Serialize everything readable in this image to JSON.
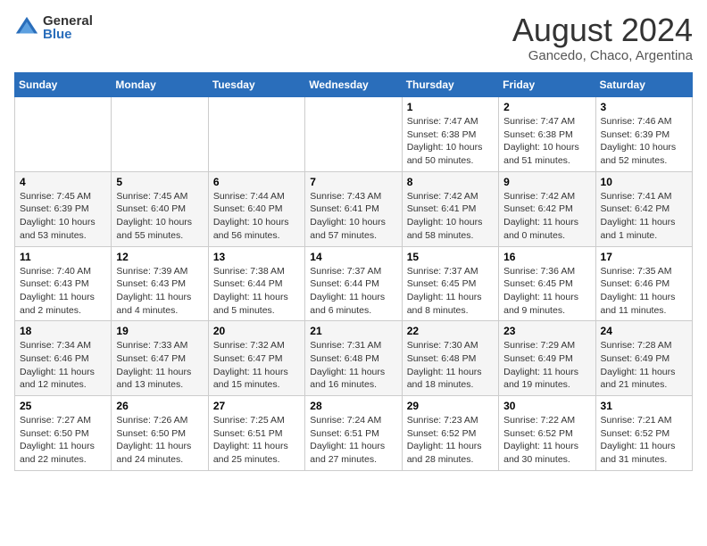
{
  "header": {
    "logo_general": "General",
    "logo_blue": "Blue",
    "title": "August 2024",
    "subtitle": "Gancedo, Chaco, Argentina"
  },
  "weekdays": [
    "Sunday",
    "Monday",
    "Tuesday",
    "Wednesday",
    "Thursday",
    "Friday",
    "Saturday"
  ],
  "weeks": [
    [
      {
        "day": "",
        "info": ""
      },
      {
        "day": "",
        "info": ""
      },
      {
        "day": "",
        "info": ""
      },
      {
        "day": "",
        "info": ""
      },
      {
        "day": "1",
        "info": "Sunrise: 7:47 AM\nSunset: 6:38 PM\nDaylight: 10 hours and 50 minutes."
      },
      {
        "day": "2",
        "info": "Sunrise: 7:47 AM\nSunset: 6:38 PM\nDaylight: 10 hours and 51 minutes."
      },
      {
        "day": "3",
        "info": "Sunrise: 7:46 AM\nSunset: 6:39 PM\nDaylight: 10 hours and 52 minutes."
      }
    ],
    [
      {
        "day": "4",
        "info": "Sunrise: 7:45 AM\nSunset: 6:39 PM\nDaylight: 10 hours and 53 minutes."
      },
      {
        "day": "5",
        "info": "Sunrise: 7:45 AM\nSunset: 6:40 PM\nDaylight: 10 hours and 55 minutes."
      },
      {
        "day": "6",
        "info": "Sunrise: 7:44 AM\nSunset: 6:40 PM\nDaylight: 10 hours and 56 minutes."
      },
      {
        "day": "7",
        "info": "Sunrise: 7:43 AM\nSunset: 6:41 PM\nDaylight: 10 hours and 57 minutes."
      },
      {
        "day": "8",
        "info": "Sunrise: 7:42 AM\nSunset: 6:41 PM\nDaylight: 10 hours and 58 minutes."
      },
      {
        "day": "9",
        "info": "Sunrise: 7:42 AM\nSunset: 6:42 PM\nDaylight: 11 hours and 0 minutes."
      },
      {
        "day": "10",
        "info": "Sunrise: 7:41 AM\nSunset: 6:42 PM\nDaylight: 11 hours and 1 minute."
      }
    ],
    [
      {
        "day": "11",
        "info": "Sunrise: 7:40 AM\nSunset: 6:43 PM\nDaylight: 11 hours and 2 minutes."
      },
      {
        "day": "12",
        "info": "Sunrise: 7:39 AM\nSunset: 6:43 PM\nDaylight: 11 hours and 4 minutes."
      },
      {
        "day": "13",
        "info": "Sunrise: 7:38 AM\nSunset: 6:44 PM\nDaylight: 11 hours and 5 minutes."
      },
      {
        "day": "14",
        "info": "Sunrise: 7:37 AM\nSunset: 6:44 PM\nDaylight: 11 hours and 6 minutes."
      },
      {
        "day": "15",
        "info": "Sunrise: 7:37 AM\nSunset: 6:45 PM\nDaylight: 11 hours and 8 minutes."
      },
      {
        "day": "16",
        "info": "Sunrise: 7:36 AM\nSunset: 6:45 PM\nDaylight: 11 hours and 9 minutes."
      },
      {
        "day": "17",
        "info": "Sunrise: 7:35 AM\nSunset: 6:46 PM\nDaylight: 11 hours and 11 minutes."
      }
    ],
    [
      {
        "day": "18",
        "info": "Sunrise: 7:34 AM\nSunset: 6:46 PM\nDaylight: 11 hours and 12 minutes."
      },
      {
        "day": "19",
        "info": "Sunrise: 7:33 AM\nSunset: 6:47 PM\nDaylight: 11 hours and 13 minutes."
      },
      {
        "day": "20",
        "info": "Sunrise: 7:32 AM\nSunset: 6:47 PM\nDaylight: 11 hours and 15 minutes."
      },
      {
        "day": "21",
        "info": "Sunrise: 7:31 AM\nSunset: 6:48 PM\nDaylight: 11 hours and 16 minutes."
      },
      {
        "day": "22",
        "info": "Sunrise: 7:30 AM\nSunset: 6:48 PM\nDaylight: 11 hours and 18 minutes."
      },
      {
        "day": "23",
        "info": "Sunrise: 7:29 AM\nSunset: 6:49 PM\nDaylight: 11 hours and 19 minutes."
      },
      {
        "day": "24",
        "info": "Sunrise: 7:28 AM\nSunset: 6:49 PM\nDaylight: 11 hours and 21 minutes."
      }
    ],
    [
      {
        "day": "25",
        "info": "Sunrise: 7:27 AM\nSunset: 6:50 PM\nDaylight: 11 hours and 22 minutes."
      },
      {
        "day": "26",
        "info": "Sunrise: 7:26 AM\nSunset: 6:50 PM\nDaylight: 11 hours and 24 minutes."
      },
      {
        "day": "27",
        "info": "Sunrise: 7:25 AM\nSunset: 6:51 PM\nDaylight: 11 hours and 25 minutes."
      },
      {
        "day": "28",
        "info": "Sunrise: 7:24 AM\nSunset: 6:51 PM\nDaylight: 11 hours and 27 minutes."
      },
      {
        "day": "29",
        "info": "Sunrise: 7:23 AM\nSunset: 6:52 PM\nDaylight: 11 hours and 28 minutes."
      },
      {
        "day": "30",
        "info": "Sunrise: 7:22 AM\nSunset: 6:52 PM\nDaylight: 11 hours and 30 minutes."
      },
      {
        "day": "31",
        "info": "Sunrise: 7:21 AM\nSunset: 6:52 PM\nDaylight: 11 hours and 31 minutes."
      }
    ]
  ]
}
